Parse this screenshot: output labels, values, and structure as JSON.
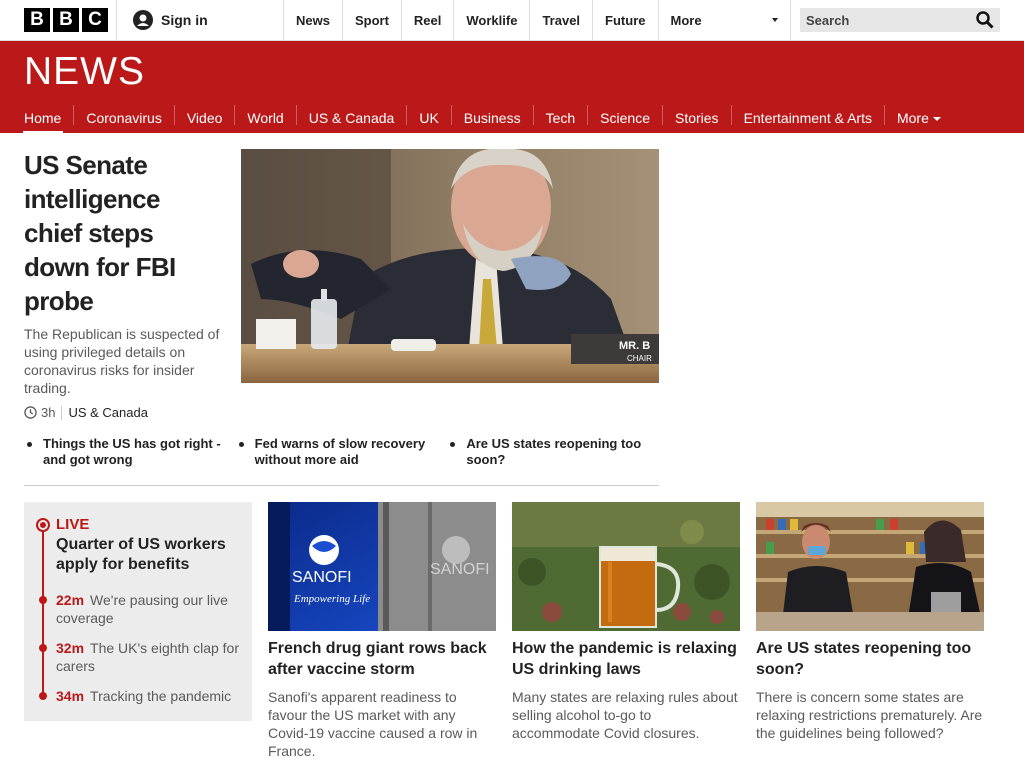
{
  "topbar": {
    "logo_letters": [
      "B",
      "B",
      "C"
    ],
    "signin": "Sign in",
    "nav": [
      "News",
      "Sport",
      "Reel",
      "Worklife",
      "Travel",
      "Future"
    ],
    "more": "More",
    "search_placeholder": "Search"
  },
  "section": {
    "logo_text": "NEWS",
    "nav": [
      "Home",
      "Coronavirus",
      "Video",
      "World",
      "US & Canada",
      "UK",
      "Business",
      "Tech",
      "Science",
      "Stories",
      "Entertainment & Arts"
    ],
    "more": "More",
    "active": "Home",
    "brand_color": "#bb1919"
  },
  "hero": {
    "title": "US Senate intelligence chief steps down for FBI probe",
    "summary": "The Republican is suspected of using privileged details on coronavirus risks for insider trading.",
    "time": "3h",
    "tag": "US & Canada",
    "placard_text": "MR. B",
    "placard_sub": "CHAIR",
    "related": [
      "Things the US has got right - and got wrong",
      "Fed warns of slow recovery without more aid",
      "Are US states reopening too soon?"
    ]
  },
  "live": {
    "label": "LIVE",
    "title": "Quarter of US workers apply for benefits",
    "entries": [
      {
        "time": "22m",
        "text": "We're pausing our live coverage"
      },
      {
        "time": "32m",
        "text": "The UK's eighth clap for carers"
      },
      {
        "time": "34m",
        "text": "Tracking the pandemic"
      }
    ]
  },
  "cards": [
    {
      "title": "French drug giant rows back after vaccine storm",
      "summary": "Sanofi's apparent readiness to favour the US market with any Covid-19 vaccine caused a row in France.",
      "img_text_1": "SANOFI",
      "img_text_2": "Empowering Life",
      "img_text_3": "SANOFI"
    },
    {
      "title": "How the pandemic is relaxing US drinking laws",
      "summary": "Many states are relaxing rules about selling alcohol to-go to accommodate Covid closures."
    },
    {
      "title": "Are US states reopening too soon?",
      "summary": "There is concern some states are relaxing restrictions prematurely. Are the guidelines being followed?"
    }
  ]
}
